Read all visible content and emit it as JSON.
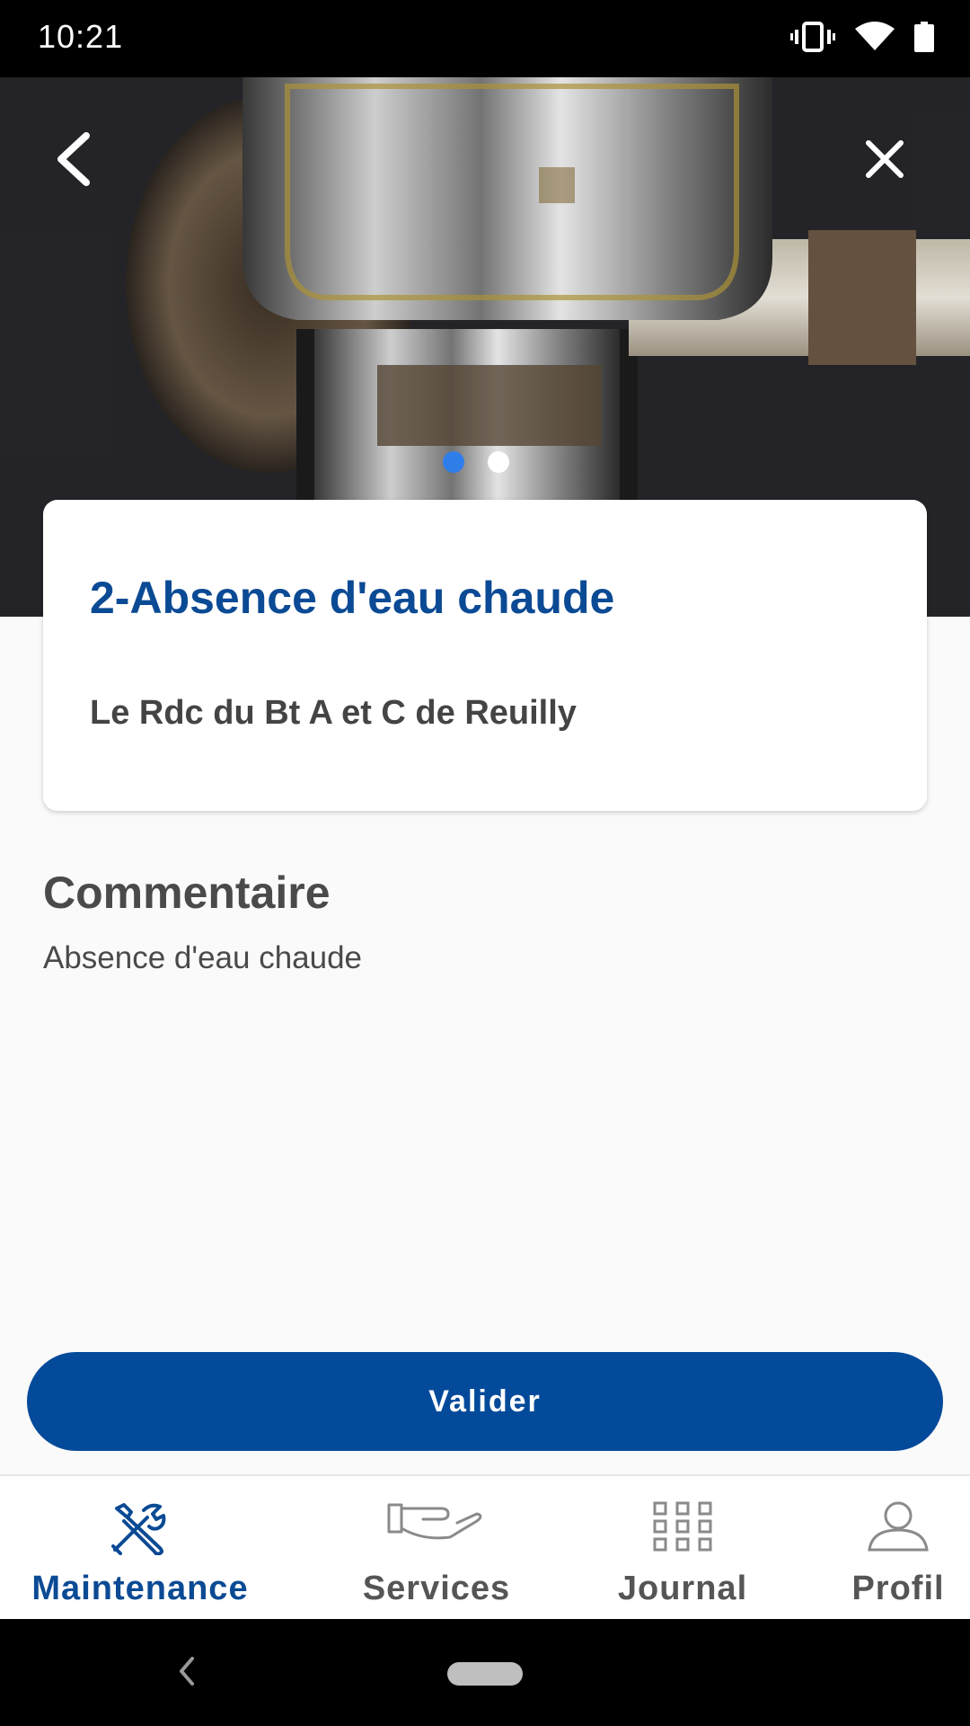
{
  "status_bar": {
    "time": "10:21",
    "icons": [
      "vibrate-icon",
      "wifi-icon",
      "battery-icon"
    ]
  },
  "hero": {
    "carousel_total": 2,
    "carousel_active": 1,
    "back_icon": "chevron-left-icon",
    "close_icon": "close-icon"
  },
  "card": {
    "title": "2-Absence d'eau chaude",
    "subtitle": "Le Rdc du Bt A et C de Reuilly"
  },
  "comment": {
    "heading": "Commentaire",
    "text": "Absence d'eau chaude"
  },
  "validate_label": "Valider",
  "tabs": [
    {
      "label": "Maintenance",
      "icon": "tools-icon",
      "active": true
    },
    {
      "label": "Services",
      "icon": "hand-icon",
      "active": false
    },
    {
      "label": "Journal",
      "icon": "grid-icon",
      "active": false
    },
    {
      "label": "Profil",
      "icon": "person-icon",
      "active": false
    }
  ],
  "colors": {
    "primary": "#044a9a",
    "title": "#0b4a94",
    "dot_active": "#2f7de9"
  }
}
